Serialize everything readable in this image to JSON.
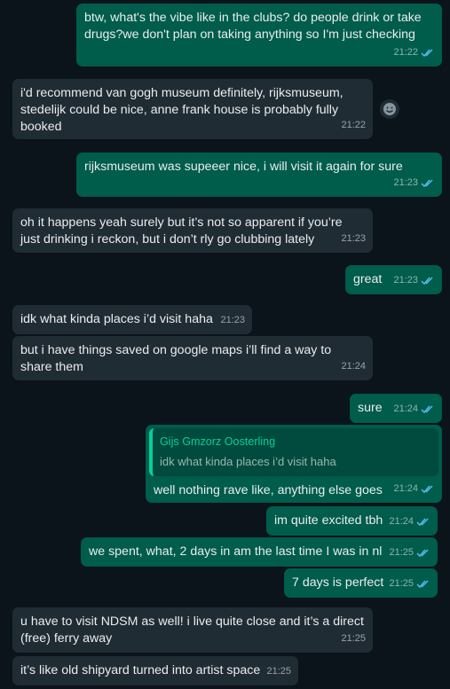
{
  "messages": [
    {
      "dir": "out",
      "text": "btw, what's the vibe like in the clubs? do people drink or take drugs?we don't plan on taking anything so I'm just checking",
      "time": "21:22",
      "read": true
    },
    {
      "dir": "in",
      "text": "i'd recommend van gogh museum definitely, rijksmuseum, stedelijk could be nice, anne frank house is probably fully booked",
      "time": "21:22",
      "reaction": "react-icon"
    },
    {
      "dir": "out",
      "text": "rijksmuseum was supeeer nice, i will visit it again for sure",
      "time": "21:23",
      "read": true
    },
    {
      "dir": "in",
      "text": "oh it happens yeah surely but it’s not so apparent if you’re just drinking i reckon, but i don’t rly go clubbing lately",
      "time": "21:23"
    },
    {
      "dir": "out",
      "text": "great",
      "time": "21:23",
      "read": true
    },
    {
      "dir": "in",
      "text": "idk what kinda places i’d visit haha",
      "time": "21:23"
    },
    {
      "dir": "in",
      "text": "but i have things saved on google maps i’ll find a way to share them",
      "time": "21:24"
    },
    {
      "dir": "out",
      "text": "sure",
      "time": "21:24",
      "read": true
    },
    {
      "dir": "out",
      "quote_author": "Gijs Gmzorz Oosterling",
      "quote_text": "idk what kinda places i’d visit haha",
      "text": "well nothing rave like, anything else goes",
      "time": "21:24",
      "read": true
    },
    {
      "dir": "out",
      "text": "im quite excited tbh",
      "time": "21:24",
      "read": true
    },
    {
      "dir": "out",
      "text": "we spent, what, 2 days in am the last time I was in nl",
      "time": "21:25",
      "read": true
    },
    {
      "dir": "out",
      "text": "7 days is perfect",
      "time": "21:25",
      "read": true
    },
    {
      "dir": "in",
      "text": "u have to visit NDSM as well! i live quite close and it’s a direct (free) ferry away",
      "time": "21:25"
    },
    {
      "dir": "in",
      "text": "it’s like old shipyard turned into artist space",
      "time": "21:25"
    }
  ],
  "colors": {
    "outgoing": "#005c4b",
    "incoming": "#202c33",
    "background": "#0b141a",
    "read_ticks": "#53bdeb",
    "quote_accent": "#06cf9c"
  }
}
